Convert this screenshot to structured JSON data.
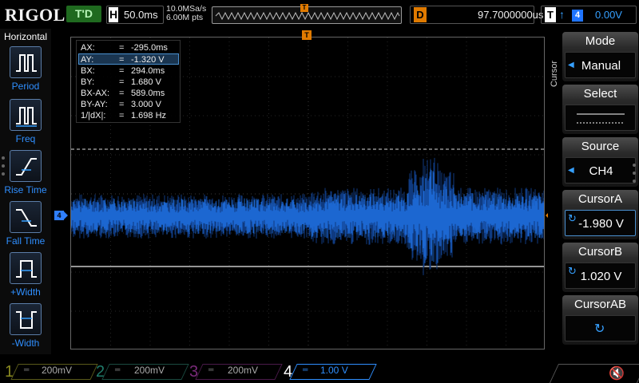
{
  "top": {
    "brand": "RIGOL",
    "run_state": "T'D",
    "timebase_letter": "H",
    "timebase": "50.0ms",
    "sample_rate": "10.0MSa/s",
    "memory_depth": "6.00M pts",
    "delay_letter": "D",
    "delay": "97.7000000us",
    "trigger_letter": "T",
    "trigger_source": "4",
    "trigger_level": "0.00V"
  },
  "left_panel": {
    "title": "Horizontal",
    "items": [
      {
        "label": "Period",
        "icon": "period-icon"
      },
      {
        "label": "Freq",
        "icon": "freq-icon"
      },
      {
        "label": "Rise Time",
        "icon": "rise-time-icon"
      },
      {
        "label": "Fall Time",
        "icon": "fall-time-icon"
      },
      {
        "label": "+Width",
        "icon": "positive-width-icon"
      },
      {
        "label": "-Width",
        "icon": "negative-width-icon"
      }
    ]
  },
  "readout": {
    "rows": [
      {
        "key": "AX:",
        "eq": "=",
        "val": "-295.0ms"
      },
      {
        "key": "AY:",
        "eq": "=",
        "val": "-1.320 V"
      },
      {
        "key": "BX:",
        "eq": "=",
        "val": "294.0ms"
      },
      {
        "key": "BY:",
        "eq": "=",
        "val": "1.680 V"
      },
      {
        "key": "BX-AX:",
        "eq": "=",
        "val": "589.0ms"
      },
      {
        "key": "BY-AY:",
        "eq": "=",
        "val": "3.000 V"
      },
      {
        "key": "1/|dX|:",
        "eq": "=",
        "val": "1.698 Hz"
      }
    ]
  },
  "markers": {
    "channel": "4",
    "trigger_position": "T",
    "trigger_level": "T"
  },
  "right_menu": {
    "side_label": "Cursor",
    "items": [
      {
        "title": "Mode",
        "value": "Manual"
      },
      {
        "title": "Select",
        "value": ""
      },
      {
        "title": "Source",
        "value": "CH4"
      },
      {
        "title": "CursorA",
        "value": "-1.980 V"
      },
      {
        "title": "CursorB",
        "value": "1.020 V"
      },
      {
        "title": "CursorAB",
        "value": ""
      }
    ]
  },
  "channels": [
    {
      "num": "1",
      "scale": "200mV",
      "color": "#8a8a20"
    },
    {
      "num": "2",
      "scale": "200mV",
      "color": "#1f7a6a"
    },
    {
      "num": "3",
      "scale": "200mV",
      "color": "#7a2a7a"
    },
    {
      "num": "4",
      "scale": "1.00 V",
      "color": "#2f8fff"
    }
  ],
  "colors": {
    "channel4_trace": "#1f6fe0",
    "trigger_accent": "#e07a00"
  }
}
